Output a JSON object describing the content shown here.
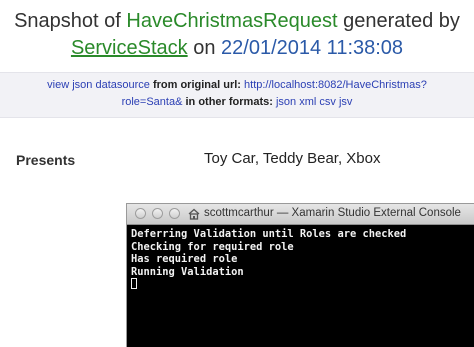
{
  "header": {
    "prefix": "Snapshot of",
    "request_name": "HaveChristmasRequest",
    "generated_by": "generated by",
    "service": "ServiceStack",
    "on": "on",
    "datetime": "22/01/2014 11:38:08"
  },
  "meta": {
    "view_json": "view json datasource",
    "from_original": "from original url:",
    "original_url_part1": "http://localhost:8082/HaveChristmas?",
    "original_url_part2": "role=Santa&",
    "other_formats": "in other formats:",
    "formats": [
      "json",
      "xml",
      "csv",
      "jsv"
    ]
  },
  "result": {
    "label": "Presents",
    "value": "Toy Car, Teddy Bear, Xbox"
  },
  "console": {
    "title": "scottmcarthur — Xamarin Studio External Console",
    "lines": [
      "Deferring Validation until Roles are checked",
      "Checking for required role",
      "Has required role",
      "Running Validation"
    ]
  },
  "colors": {
    "green": "#2a8a2a",
    "link_blue": "#2b3fb4",
    "date_blue": "#2b5aa8",
    "console_bg": "#000000"
  }
}
